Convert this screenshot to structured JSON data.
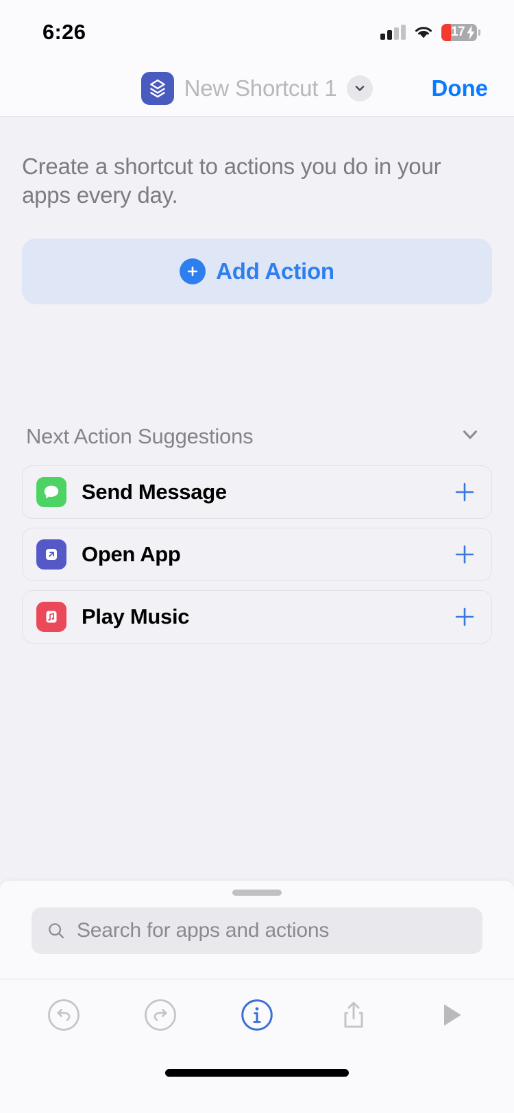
{
  "status_bar": {
    "time": "6:26",
    "signal_icon": "cellular-signal-icon",
    "wifi_icon": "wifi-icon",
    "battery_level": "17",
    "battery_charging": true,
    "battery_color": "#f23a2e"
  },
  "nav_bar": {
    "app_icon": "shortcuts-layers-icon",
    "title": "New Shortcut 1",
    "chevron_icon": "chevron-down-icon",
    "done_label": "Done",
    "accent_color": "#0a7aff"
  },
  "main": {
    "intro_text": "Create a shortcut to actions you do in your apps every day.",
    "add_action": {
      "label": "Add Action",
      "icon": "plus-circle-icon",
      "color": "#2d7ff0",
      "background": "#dfe6f5"
    },
    "suggestions": {
      "title": "Next Action Suggestions",
      "collapse_icon": "chevron-down-icon",
      "items": [
        {
          "label": "Send Message",
          "icon": "messages-bubble-icon",
          "icon_color": "#4cd364",
          "add_icon": "plus-icon"
        },
        {
          "label": "Open App",
          "icon": "open-app-arrow-icon",
          "icon_color": "#5559c8",
          "add_icon": "plus-icon"
        },
        {
          "label": "Play Music",
          "icon": "music-note-icon",
          "icon_color": "#eb4859",
          "add_icon": "plus-icon"
        }
      ]
    }
  },
  "bottom_sheet": {
    "grabber": "sheet-grabber",
    "search": {
      "icon": "search-icon",
      "placeholder": "Search for apps and actions",
      "value": ""
    }
  },
  "toolbar": {
    "items": [
      {
        "name": "undo-button",
        "icon": "undo-icon",
        "active": false
      },
      {
        "name": "redo-button",
        "icon": "redo-icon",
        "active": false
      },
      {
        "name": "info-button",
        "icon": "info-circle-icon",
        "active": true
      },
      {
        "name": "share-button",
        "icon": "share-icon",
        "active": false
      },
      {
        "name": "play-button",
        "icon": "play-icon",
        "active": false
      }
    ],
    "active_color": "#3a6fd8",
    "inactive_color": "#b8b8bd"
  },
  "home_indicator": "home-indicator"
}
